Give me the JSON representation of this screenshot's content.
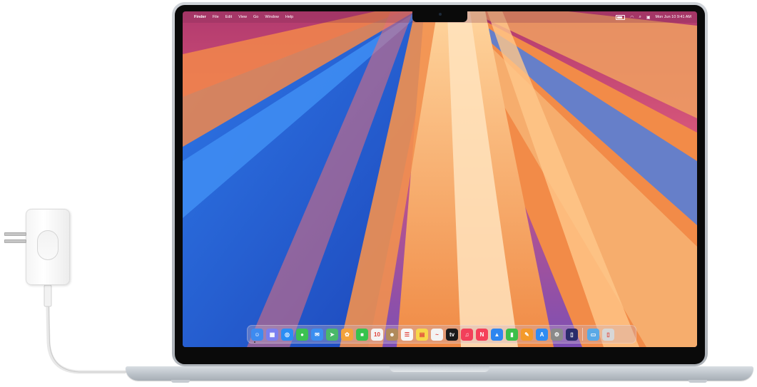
{
  "menubar": {
    "app_name": "Finder",
    "menus": [
      "File",
      "Edit",
      "View",
      "Go",
      "Window",
      "Help"
    ],
    "clock": "Mon Jun 10  9:41 AM"
  },
  "dock": {
    "apps": [
      {
        "name": "finder-icon",
        "color": "#3d8bf0",
        "glyph": "☺"
      },
      {
        "name": "launchpad-icon",
        "color": "#7a7ff0",
        "glyph": "▦"
      },
      {
        "name": "safari-icon",
        "color": "#2a8ef5",
        "glyph": "◎"
      },
      {
        "name": "messages-icon",
        "color": "#3cc152",
        "glyph": "●"
      },
      {
        "name": "mail-icon",
        "color": "#3a8ef0",
        "glyph": "✉"
      },
      {
        "name": "maps-icon",
        "color": "#4ab86a",
        "glyph": "➤"
      },
      {
        "name": "photos-icon",
        "color": "#f3a23b",
        "glyph": "✿"
      },
      {
        "name": "facetime-icon",
        "color": "#36c34d",
        "glyph": "■"
      },
      {
        "name": "calendar-icon",
        "color": "#f4f4f4",
        "glyph": "10"
      },
      {
        "name": "contacts-icon",
        "color": "#b08a5b",
        "glyph": "☻"
      },
      {
        "name": "reminders-icon",
        "color": "#f7f7f7",
        "glyph": "☰"
      },
      {
        "name": "notes-icon",
        "color": "#f7d84a",
        "glyph": "▤"
      },
      {
        "name": "freeform-icon",
        "color": "#f3f3f3",
        "glyph": "~"
      },
      {
        "name": "tv-icon",
        "color": "#1a1a1a",
        "glyph": "tv"
      },
      {
        "name": "music-icon",
        "color": "#f2405a",
        "glyph": "♫"
      },
      {
        "name": "news-icon",
        "color": "#f5405a",
        "glyph": "N"
      },
      {
        "name": "keynote-icon",
        "color": "#2f86f0",
        "glyph": "▲"
      },
      {
        "name": "numbers-icon",
        "color": "#3bbf4a",
        "glyph": "▮"
      },
      {
        "name": "pages-icon",
        "color": "#f49a2a",
        "glyph": "✎"
      },
      {
        "name": "app-store-icon",
        "color": "#2f8cf2",
        "glyph": "A"
      },
      {
        "name": "system-settings-icon",
        "color": "#8a8a8a",
        "glyph": "⚙"
      },
      {
        "name": "iphone-mirroring-icon",
        "color": "#2b2b6a",
        "glyph": "▯"
      }
    ],
    "after_separator": [
      {
        "name": "downloads-folder-icon",
        "color": "#5aa9e6",
        "glyph": "▭"
      },
      {
        "name": "trash-icon",
        "color": "#d7d7d7",
        "glyph": "▯"
      }
    ]
  }
}
